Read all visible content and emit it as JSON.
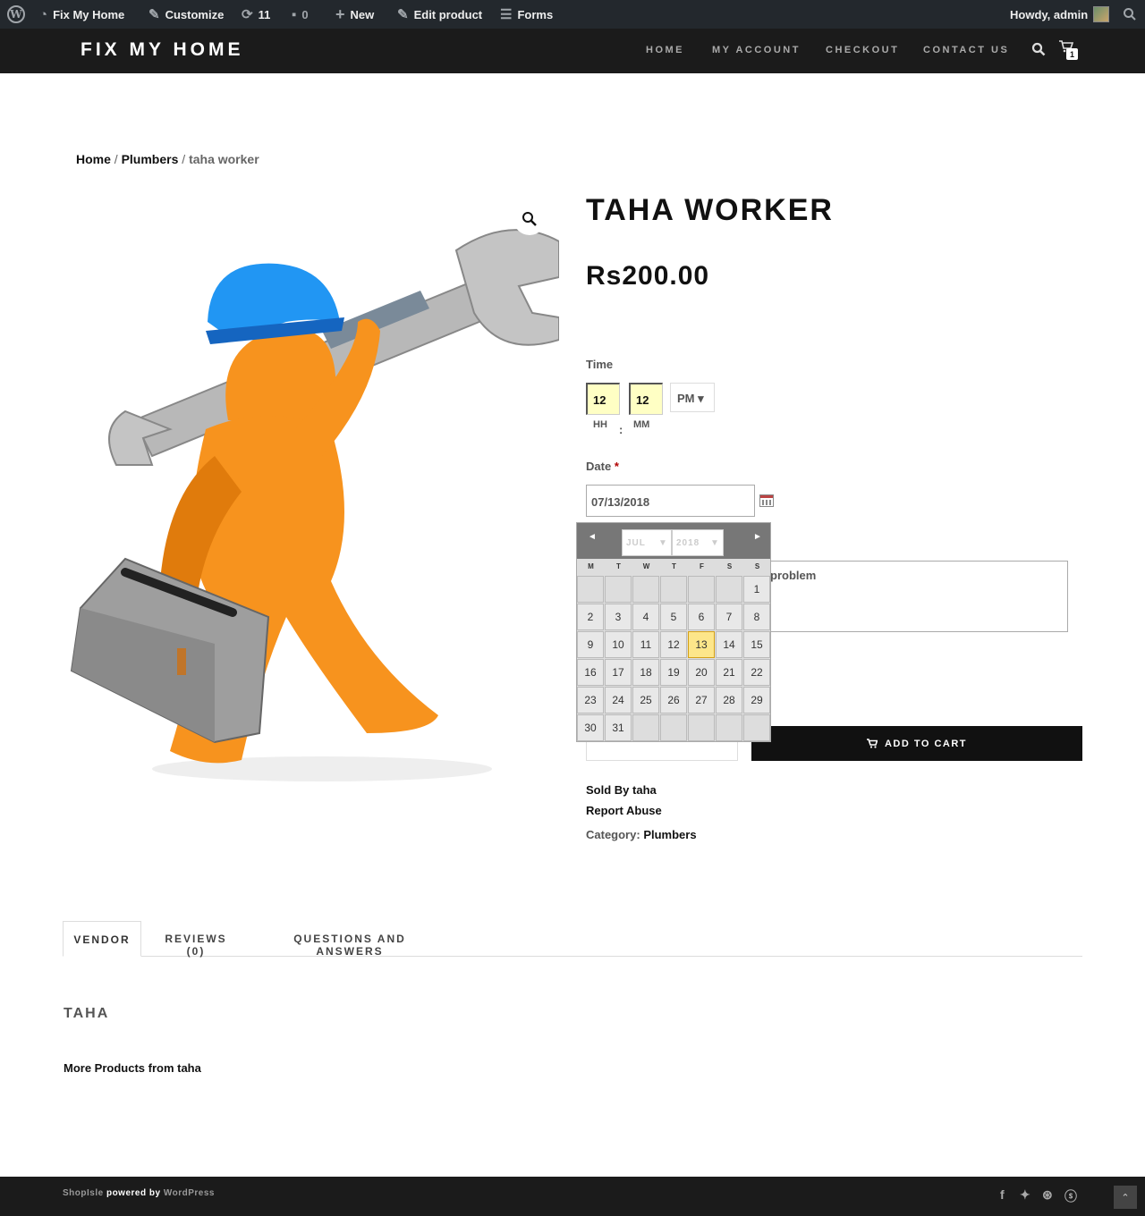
{
  "adminbar": {
    "site_name": "Fix My Home",
    "customize": "Customize",
    "updates_count": "11",
    "comments_count": "0",
    "new_label": "New",
    "edit_product": "Edit product",
    "forms": "Forms",
    "howdy": "Howdy, admin"
  },
  "header": {
    "logo": "FIX MY HOME",
    "nav": [
      "HOME",
      "MY ACCOUNT",
      "CHECKOUT",
      "CONTACT US"
    ],
    "cart_count": "1"
  },
  "breadcrumb": {
    "home": "Home",
    "category": "Plumbers",
    "current": "taha worker",
    "separator": "/"
  },
  "product": {
    "title": "TAHA WORKER",
    "price": "Rs200.00",
    "time_label": "Time",
    "hour": "12",
    "minute": "12",
    "hh_label": "HH",
    "mm_label": "MM",
    "colon": ":",
    "ampm": "PM ▾",
    "date_label": "Date",
    "required": "*",
    "date_value": "07/13/2018",
    "textarea_text": "problem",
    "add_to_cart": "ADD TO CART",
    "sold_by_label": "Sold By",
    "sold_by": "taha",
    "report_abuse": "Report Abuse",
    "category_label": "Category:",
    "category": "Plumbers"
  },
  "datepicker": {
    "month": "JUL",
    "year": "2018",
    "days_of_week": [
      "M",
      "T",
      "W",
      "T",
      "F",
      "S",
      "S"
    ],
    "selected_day": "13",
    "leading_blanks": 6,
    "days_in_month": 31
  },
  "tabs": [
    "VENDOR",
    "REVIEWS (0)",
    "QUESTIONS AND ANSWERS"
  ],
  "vendor": {
    "name": "TAHA",
    "more_products": "More Products from taha"
  },
  "footer": {
    "theme": "ShopIsle",
    "powered": "powered by",
    "platform": "WordPress"
  },
  "colors": {
    "admin_bar": "#23282d",
    "header": "#1b1b1b",
    "selected_day": "#fde68a",
    "time_input_bg": "#ffffc4"
  }
}
